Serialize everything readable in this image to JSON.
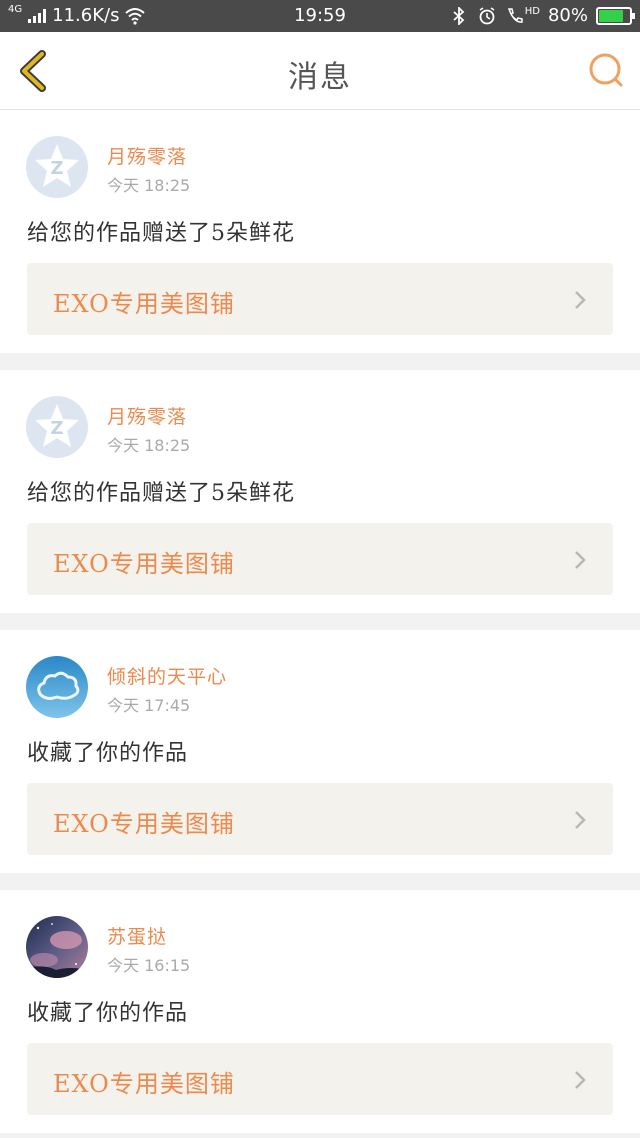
{
  "status_bar": {
    "network": "4G",
    "speed": "11.6K/s",
    "time": "19:59",
    "hd": "HD",
    "battery_percent": "80%",
    "battery_level": 0.8,
    "icons": [
      "signal-icon",
      "wifi-icon",
      "bluetooth-icon",
      "alarm-icon",
      "call-icon",
      "battery-icon"
    ]
  },
  "header": {
    "title": "消息",
    "back_icon": "chevron-left-icon",
    "search_icon": "search-icon"
  },
  "messages": [
    {
      "user": "月殇零落",
      "time": "今天  18:25",
      "text": "给您的作品赠送了5朵鲜花",
      "link": "EXO专用美图铺",
      "avatar": "qq-default"
    },
    {
      "user": "月殇零落",
      "time": "今天  18:25",
      "text": "给您的作品赠送了5朵鲜花",
      "link": "EXO专用美图铺",
      "avatar": "qq-default"
    },
    {
      "user": "倾斜的天平心",
      "time": "今天  17:45",
      "text": "收藏了你的作品",
      "link": "EXO专用美图铺",
      "avatar": "cloud-sky"
    },
    {
      "user": "苏蛋挞",
      "time": "今天  16:15",
      "text": "收藏了你的作品",
      "link": "EXO专用美图铺",
      "avatar": "night-sky"
    }
  ],
  "colors": {
    "accent": "#ec8a4e",
    "status_bar": "#4a4a4a",
    "link_bg": "#f3f2ec",
    "battery_green": "#35d04a",
    "back_icon": "#e0b720"
  }
}
